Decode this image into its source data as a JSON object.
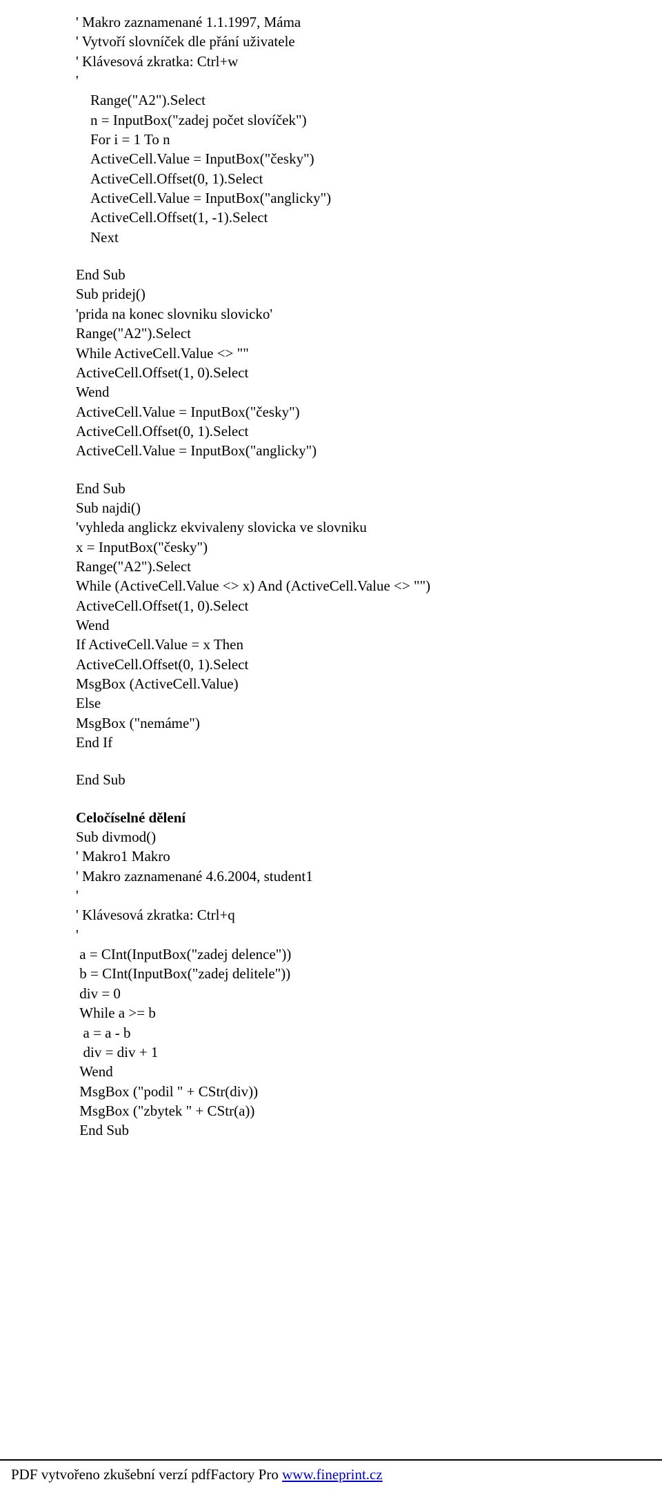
{
  "block1": [
    "' Makro zaznamenané 1.1.1997, Máma",
    "' Vytvoří slovníček dle přání uživatele",
    "' Klávesová zkratka: Ctrl+w",
    "'",
    "    Range(\"A2\").Select",
    "    n = InputBox(\"zadej počet slovíček\")",
    "    For i = 1 To n",
    "    ActiveCell.Value = InputBox(\"česky\")",
    "    ActiveCell.Offset(0, 1).Select",
    "    ActiveCell.Value = InputBox(\"anglicky\")",
    "    ActiveCell.Offset(1, -1).Select",
    "    Next"
  ],
  "block2": [
    "End Sub",
    "Sub pridej()",
    "'prida na konec slovniku slovicko'",
    "Range(\"A2\").Select",
    "While ActiveCell.Value <> \"\"",
    "ActiveCell.Offset(1, 0).Select",
    "Wend",
    "ActiveCell.Value = InputBox(\"česky\")",
    "ActiveCell.Offset(0, 1).Select",
    "ActiveCell.Value = InputBox(\"anglicky\")"
  ],
  "block3": [
    "End Sub",
    "Sub najdi()",
    "'vyhleda anglickz ekvivaleny slovicka ve slovniku",
    "x = InputBox(\"česky\")",
    "Range(\"A2\").Select",
    "While (ActiveCell.Value <> x) And (ActiveCell.Value <> \"\")",
    "ActiveCell.Offset(1, 0).Select",
    "Wend",
    "If ActiveCell.Value = x Then",
    "ActiveCell.Offset(0, 1).Select",
    "MsgBox (ActiveCell.Value)",
    "Else",
    "MsgBox (\"nemáme\")",
    "End If"
  ],
  "block4": [
    "End Sub"
  ],
  "heading": "Celočíselné dělení",
  "block5": [
    "Sub divmod()",
    "' Makro1 Makro",
    "' Makro zaznamenané 4.6.2004, student1",
    "'",
    "' Klávesová zkratka: Ctrl+q",
    "'",
    " a = CInt(InputBox(\"zadej delence\"))",
    " b = CInt(InputBox(\"zadej delitele\"))",
    " div = 0",
    " While a >= b",
    "  a = a - b",
    "  div = div + 1",
    " Wend",
    " MsgBox (\"podil \" + CStr(div))",
    " MsgBox (\"zbytek \" + CStr(a))",
    " End Sub"
  ],
  "footer": {
    "prefix": "PDF vytvořeno zkušební verzí pdfFactory Pro ",
    "link": "www.fineprint.cz"
  }
}
